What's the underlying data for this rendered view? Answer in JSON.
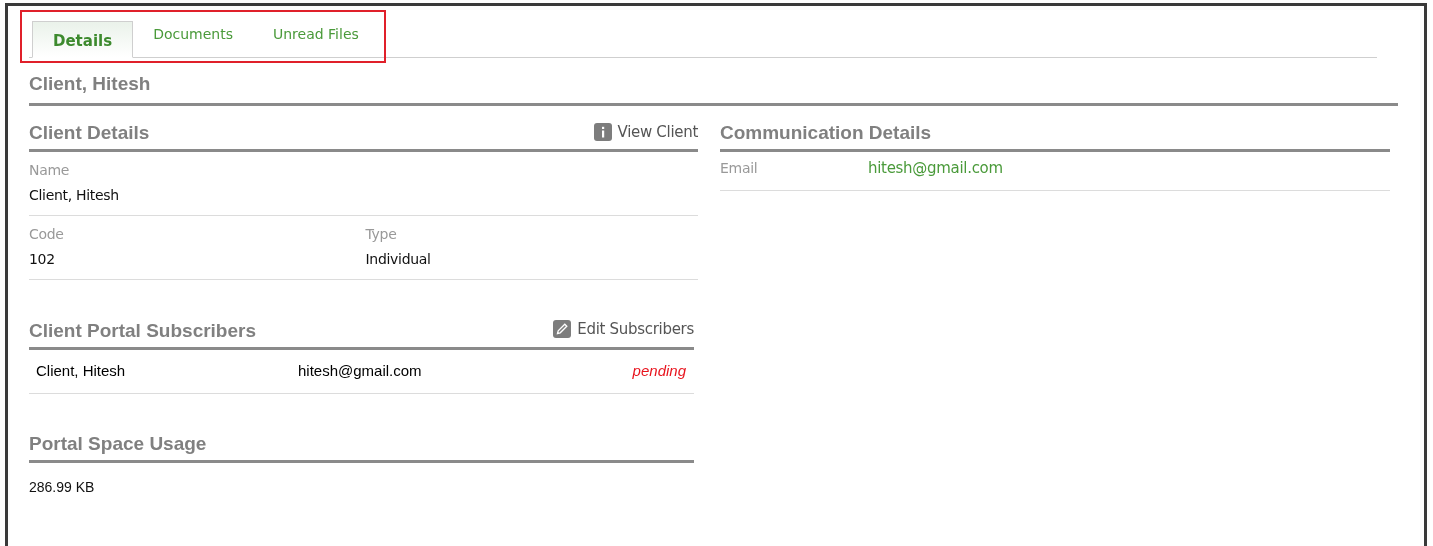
{
  "tabs": [
    {
      "label": "Details",
      "selected": true
    },
    {
      "label": "Documents",
      "selected": false
    },
    {
      "label": "Unread Files",
      "selected": false
    }
  ],
  "highlight": {
    "color": "#e0202a"
  },
  "title": "Client, Hitesh",
  "client_details": {
    "heading": "Client Details",
    "action": "View Client",
    "fields": [
      [
        {
          "label": "Name",
          "value": "Client, Hitesh"
        }
      ],
      [
        {
          "label": "Code",
          "value": "102"
        },
        {
          "label": "Type",
          "value": "Individual"
        }
      ]
    ]
  },
  "subscribers": {
    "heading": "Client Portal Subscribers",
    "action": "Edit Subscribers",
    "rows": [
      {
        "name": "Client, Hitesh",
        "email": "hitesh@gmail.com",
        "status": "pending"
      }
    ]
  },
  "usage": {
    "heading": "Portal Space Usage",
    "value": "286.99 KB"
  },
  "communication": {
    "heading": "Communication Details",
    "fields": [
      {
        "label": "Email",
        "value": "hitesh@gmail.com"
      }
    ]
  }
}
